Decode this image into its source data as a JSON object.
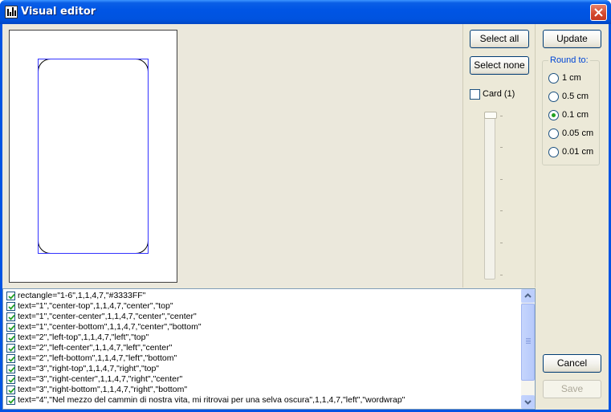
{
  "window": {
    "title": "Visual editor",
    "title_icon": "app-icon",
    "close_icon": "close-icon"
  },
  "selection": {
    "select_all_label": "Select all",
    "select_none_label": "Select none",
    "card_checkbox_label": "Card (1)",
    "card_checked": false
  },
  "actions": {
    "update_label": "Update",
    "cancel_label": "Cancel",
    "save_label": "Save"
  },
  "rounding": {
    "legend": "Round to:",
    "options": [
      {
        "label": "1 cm",
        "checked": false
      },
      {
        "label": "0.5 cm",
        "checked": false
      },
      {
        "label": "0.1 cm",
        "checked": true
      },
      {
        "label": "0.05 cm",
        "checked": false
      },
      {
        "label": "0.01 cm",
        "checked": false
      }
    ]
  },
  "elements": [
    {
      "text": "rectangle=\"1-6\",1,1,4,7,\"#3333FF\"",
      "checked": true
    },
    {
      "text": "text=\"1\",\"center-top\",1,1,4,7,\"center\",\"top\"",
      "checked": true
    },
    {
      "text": "text=\"1\",\"center-center\",1,1,4,7,\"center\",\"center\"",
      "checked": true
    },
    {
      "text": "text=\"1\",\"center-bottom\",1,1,4,7,\"center\",\"bottom\"",
      "checked": true
    },
    {
      "text": "text=\"2\",\"left-top\",1,1,4,7,\"left\",\"top\"",
      "checked": true
    },
    {
      "text": "text=\"2\",\"left-center\",1,1,4,7,\"left\",\"center\"",
      "checked": true
    },
    {
      "text": "text=\"2\",\"left-bottom\",1,1,4,7,\"left\",\"bottom\"",
      "checked": true
    },
    {
      "text": "text=\"3\",\"right-top\",1,1,4,7,\"right\",\"top\"",
      "checked": true
    },
    {
      "text": "text=\"3\",\"right-center\",1,1,4,7,\"right\",\"center\"",
      "checked": true
    },
    {
      "text": "text=\"3\",\"right-bottom\",1,1,4,7,\"right\",\"bottom\"",
      "checked": true
    },
    {
      "text": "text=\"4\",\"Nel mezzo del cammin di nostra vita, mi ritrovai per una selva oscura\",1,1,4,7,\"left\",\"wordwrap\"",
      "checked": true
    }
  ],
  "colors": {
    "titlebar": "#0054e3",
    "dialog_bg": "#ece9d8",
    "bbox": "#3333ff",
    "radio_dot": "#21a121",
    "check_mark": "#21a121"
  }
}
